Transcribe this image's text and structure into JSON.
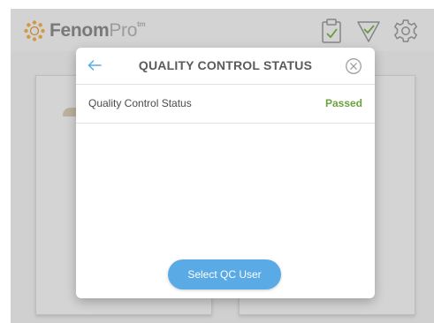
{
  "app": {
    "logo_bold": "Fenom",
    "logo_light": "Pro",
    "logo_mark": "tm",
    "icons": [
      "clipboard-check-icon",
      "triangle-check-icon",
      "gear-icon"
    ]
  },
  "modal": {
    "title": "QUALITY CONTROL STATUS",
    "back_icon": "arrow-left-icon",
    "close_icon": "close-circle-icon",
    "status_label": "Quality Control Status",
    "status_value": "Passed",
    "button_label": "Select QC User"
  },
  "colors": {
    "accent_blue": "#5aaae6",
    "passed_green": "#6aa33a",
    "title_gray": "#5a5a5a",
    "logo_orange": "#e8a23b"
  }
}
